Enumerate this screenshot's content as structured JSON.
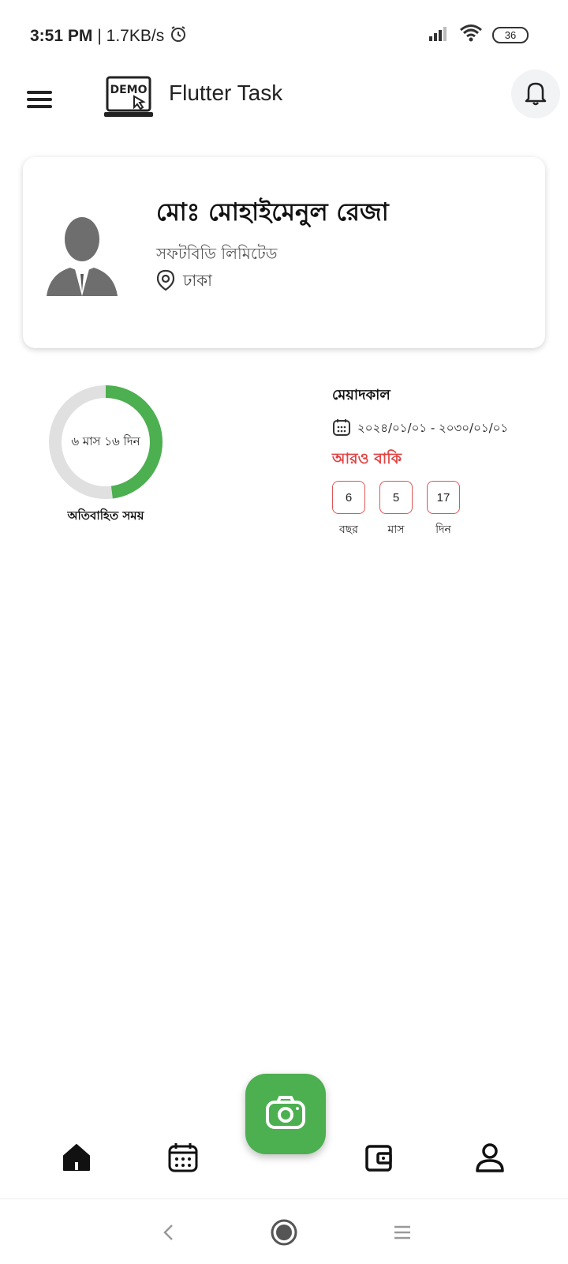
{
  "status_bar": {
    "time": "3:51 PM",
    "network_speed": "| 1.7KB/s",
    "battery": "36",
    "icons": [
      "alarm-icon",
      "signal-icon",
      "wifi-icon",
      "battery-icon"
    ]
  },
  "appbar": {
    "logo_text": "DEMO",
    "title": "Flutter Task"
  },
  "profile": {
    "name": "মোঃ মোহাইমেনুল রেজা",
    "company": "সফটবিডি লিমিটেড",
    "location": "ঢাকা"
  },
  "elapsed": {
    "label": "৬ মাস ১৬ দিন",
    "caption": "অতিবাহিত সময়",
    "fraction": 0.48
  },
  "validity": {
    "title": "মেয়াদকাল",
    "range": "২০২৪/০১/০১ - ২০৩০/০১/০১",
    "remaining_title": "আরও বাকি",
    "counts": [
      {
        "value": "6",
        "label": "বছর"
      },
      {
        "value": "5",
        "label": "মাস"
      },
      {
        "value": "17",
        "label": "দিন"
      }
    ]
  },
  "colors": {
    "accent": "#4caf50",
    "warning": "#e04444",
    "track": "#e0e0e0"
  },
  "bottom_nav": {
    "items": [
      "home-icon",
      "calendar-icon",
      "camera-icon",
      "wallet-icon",
      "profile-icon"
    ]
  }
}
